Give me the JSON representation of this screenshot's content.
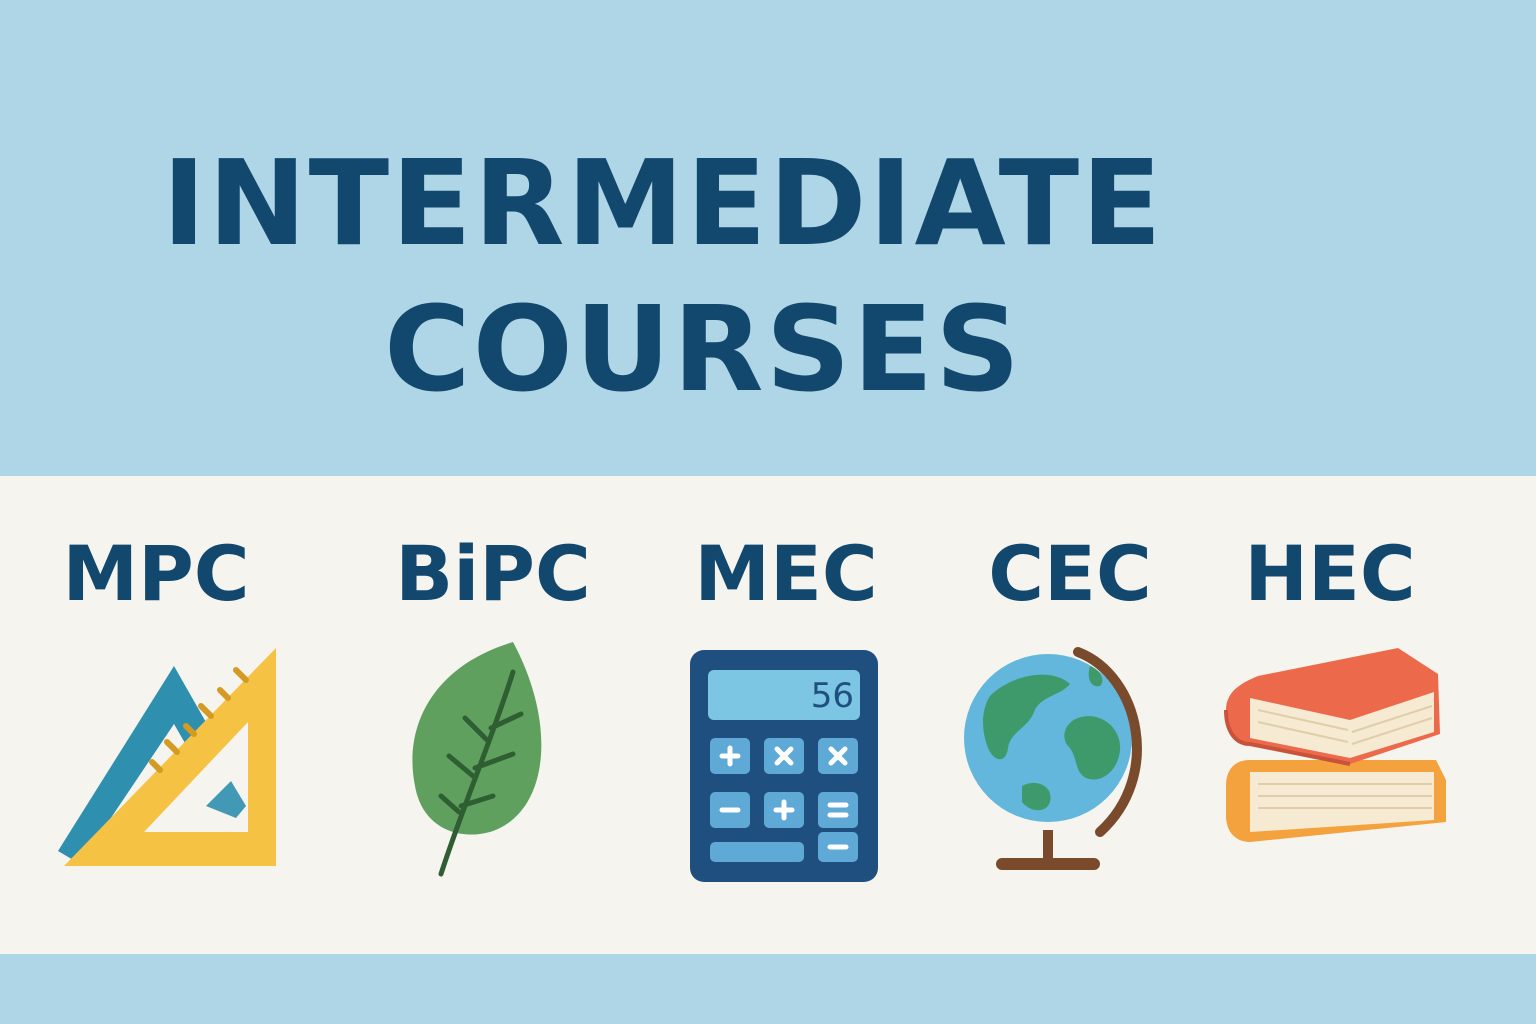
{
  "title": {
    "line1": "INTERMEDIATE",
    "line2": "COURSES"
  },
  "courses": [
    {
      "label": "MPC",
      "icon": "geometry-set-square-icon"
    },
    {
      "label": "BiPC",
      "icon": "leaf-icon"
    },
    {
      "label": "MEC",
      "icon": "calculator-icon",
      "display_value": "56"
    },
    {
      "label": "CEC",
      "icon": "globe-icon"
    },
    {
      "label": "HEC",
      "icon": "books-stack-icon"
    }
  ],
  "colors": {
    "background": "#afd6e6",
    "band": "#f5f4ef",
    "text": "#13486e",
    "teal": "#2f8fae",
    "yellow": "#f6c244",
    "green": "#5fa05f",
    "calculator": "#1f4f7f",
    "globe_ocean": "#63b6dc",
    "globe_land": "#3f9a6b",
    "stand": "#7a4a2c",
    "book_red": "#ec6a4b",
    "book_orange": "#f3a23d"
  }
}
